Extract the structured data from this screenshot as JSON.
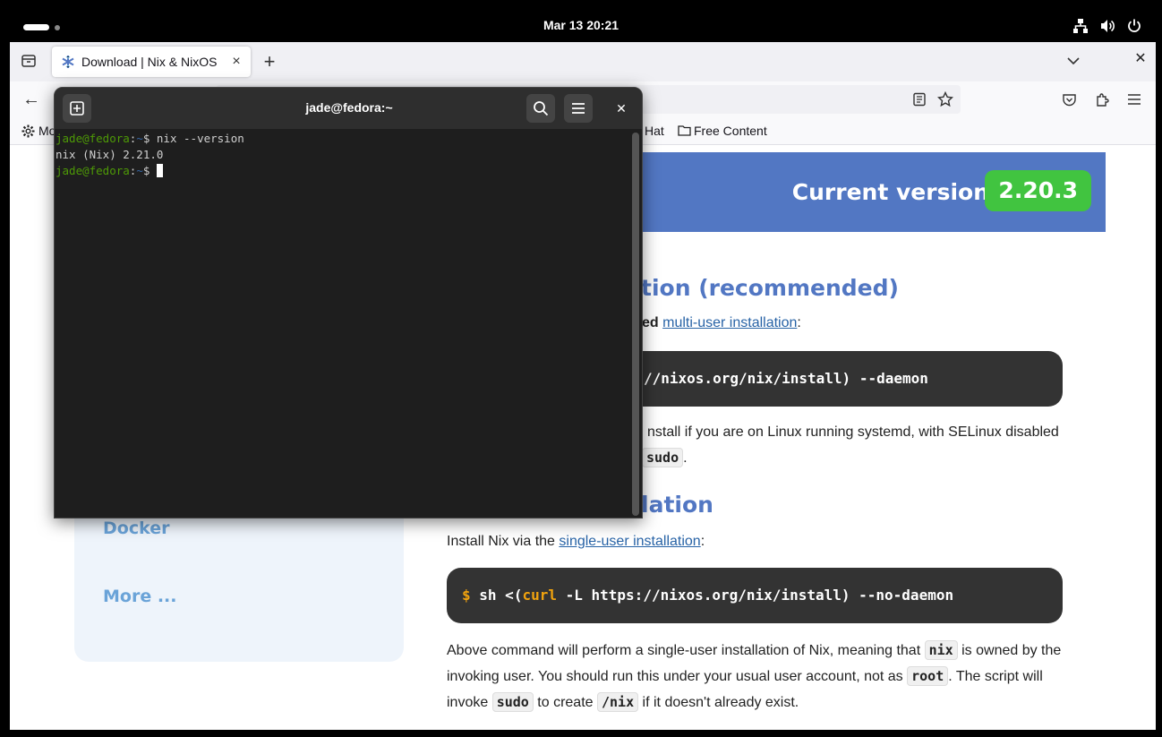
{
  "topbar": {
    "clock": "Mar 13  20:21"
  },
  "browser": {
    "tab_title": "Download | Nix & NixOS",
    "bookmarks": {
      "most_visited": "Mo",
      "red_hat": "Hat",
      "free_content": "Free Content"
    }
  },
  "page": {
    "version_label": "Current version",
    "version_value": "2.20.3",
    "multi_heading": "tion (recommended)",
    "multi_intro_bold": "ed",
    "multi_intro_link": "multi-user installation",
    "multi_intro_end": ":",
    "multi_cmd": "//nixos.org/nix/install) --daemon",
    "multi_note": "nstall if you are on Linux running systemd, with SELinux disabled",
    "multi_note_code": "sudo",
    "multi_note_end": ".",
    "single_heading": "lation",
    "single_intro_text": "Install Nix via the ",
    "single_intro_link": "single-user installation",
    "single_intro_end": ":",
    "single_cmd_dollar": "$",
    "single_cmd_pre": "sh <(",
    "single_cmd_curl": "curl",
    "single_cmd_post": " -L https://nixos.org/nix/install) --no-daemon",
    "single_desc_1": "Above command will perform a single-user installation of Nix, meaning that ",
    "single_desc_code1": "nix",
    "single_desc_2": " is owned by the invoking user. You should run this under your usual user account, not as ",
    "single_desc_code2": "root",
    "single_desc_3": ". The script will invoke ",
    "single_desc_code3": "sudo",
    "single_desc_4": " to create ",
    "single_desc_code4": "/nix",
    "single_desc_5": " if it doesn't already exist.",
    "sidebar_docker": "Docker",
    "sidebar_more": "More ..."
  },
  "terminal": {
    "title": "jade@fedora:~",
    "lines": {
      "l1_user": "jade@fedora",
      "l1_sep": ":",
      "l1_path": "~",
      "l1_cmd": "$ nix --version",
      "l2": "nix (Nix) 2.21.0",
      "l3_user": "jade@fedora",
      "l3_sep": ":",
      "l3_path": "~",
      "l3_prompt": "$ "
    }
  },
  "colors": {
    "nix_blue": "#5277c3",
    "version_green": "#41c440",
    "terminal_bg": "#1e1e1e"
  }
}
